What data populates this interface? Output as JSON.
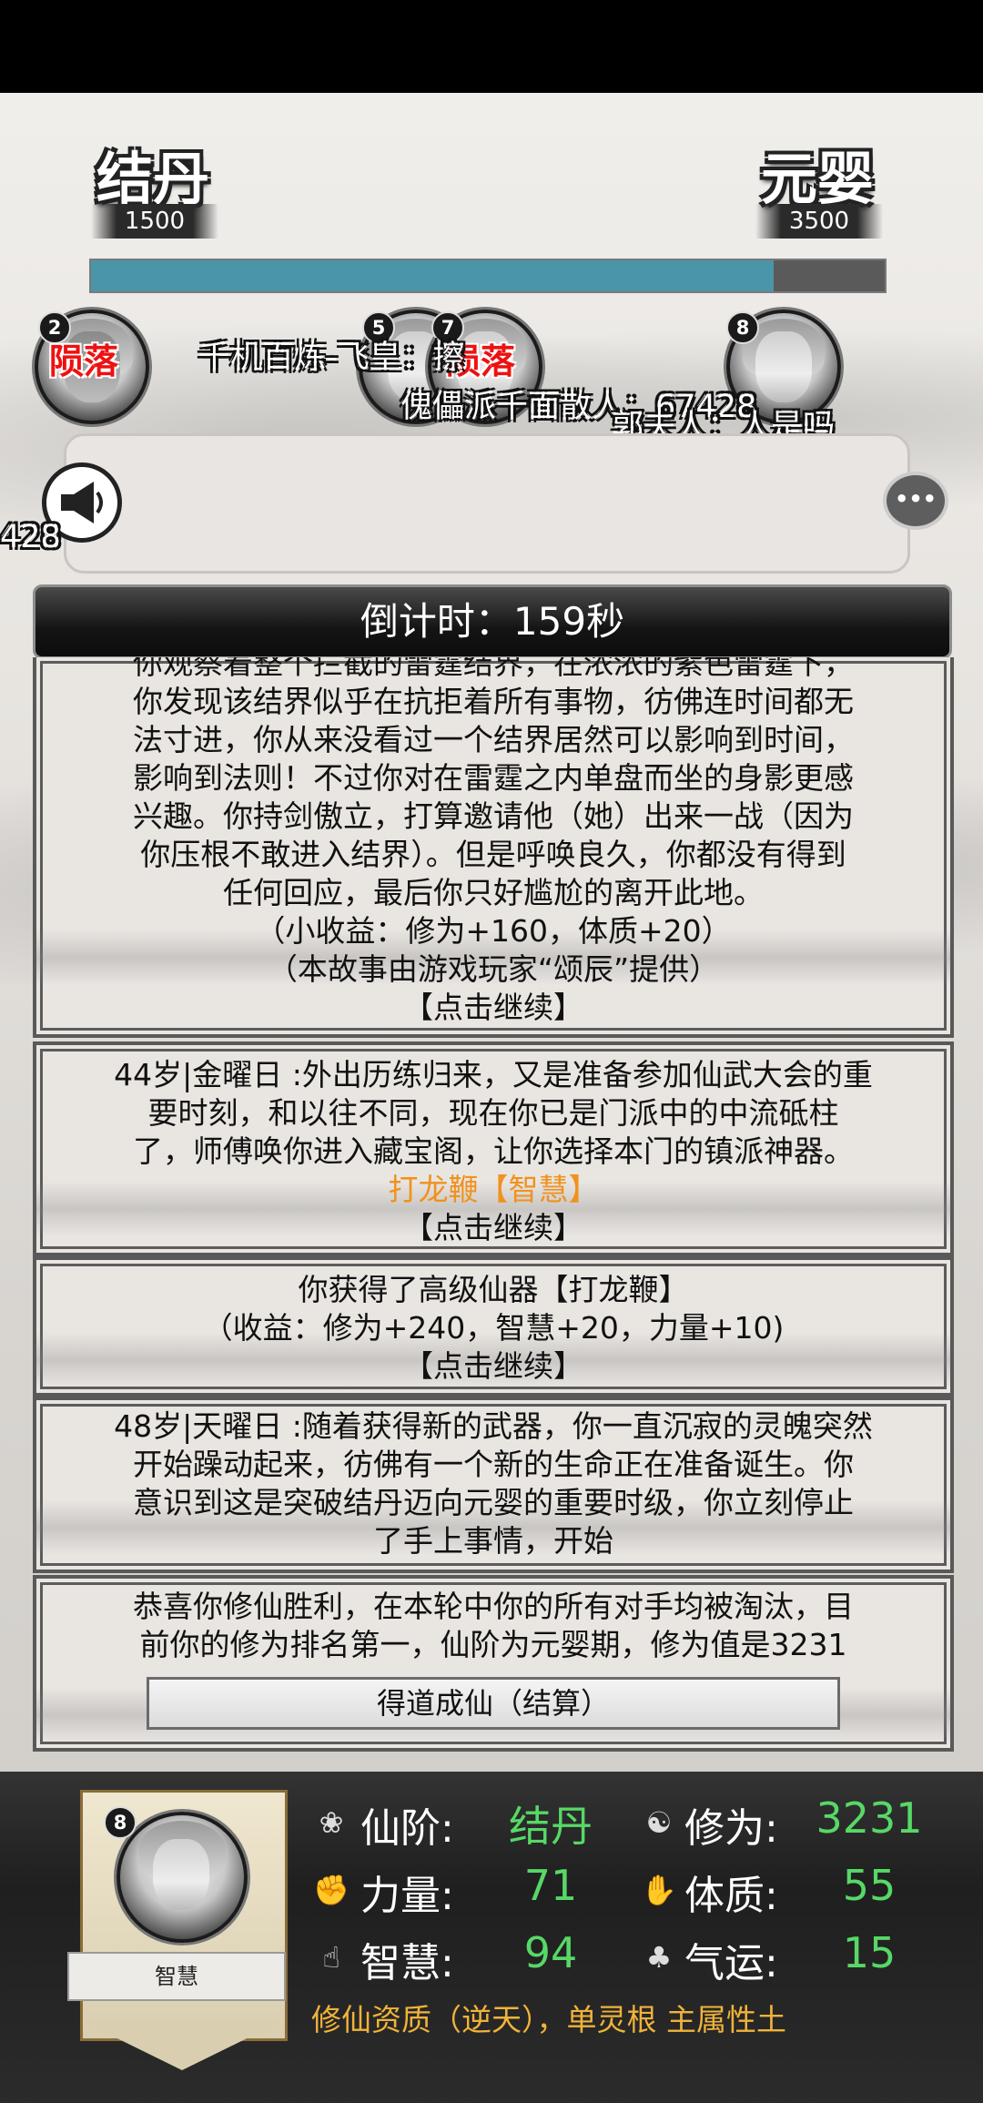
{
  "header": {
    "rank_left": "结丹",
    "rank_left_value": "1500",
    "rank_right": "元婴",
    "rank_right_value": "3500",
    "progress_fraction": 0.86
  },
  "players": [
    {
      "number": "2",
      "status": "陨落"
    },
    {
      "number": "5",
      "status": ""
    },
    {
      "number": "7",
      "status": "陨落"
    },
    {
      "number": "8",
      "status": ""
    }
  ],
  "float_texts": {
    "line1": "千机百炼-飞皇：擦",
    "line2": "傀儡派千面散人：67428",
    "line3": "郭夫人：人是吗",
    "edge": "428"
  },
  "countdown": "倒计时：159秒",
  "story": {
    "card1": {
      "lines": [
        "你观察着整个拦截的雷霆结界，在浓浓的紫色雷霆下，",
        "你发现该结界似乎在抗拒着所有事物，彷佛连时间都无",
        "法寸进，你从来没看过一个结界居然可以影响到时间，",
        "影响到法则！不过你对在雷霆之内单盘而坐的身影更感",
        "兴趣。你持剑傲立，打算邀请他（她）出来一战（因为",
        "你压根不敢进入结界）。但是呼唤良久，你都没有得到",
        "任何回应，最后你只好尴尬的离开此地。"
      ],
      "gain": "（小收益：修为+160，体质+20）",
      "credit": "（本故事由游戏玩家“颂辰”提供）",
      "continue": "【点击继续】"
    },
    "card2": {
      "lines": [
        "44岁|金曜日 :外出历练归来，又是准备参加仙武大会的重",
        "要时刻，和以往不同，现在你已是门派中的中流砥柱",
        "了，师傅唤你进入藏宝阁，让你选择本门的镇派神器。"
      ],
      "item": "打龙鞭【智慧】",
      "continue": "【点击继续】"
    },
    "card3": {
      "line": "你获得了高级仙器【打龙鞭】",
      "gain": "（收益：修为+240，智慧+20，力量+10)",
      "continue": "【点击继续】"
    },
    "card4": {
      "lines": [
        "48岁|天曜日 :随着获得新的武器，你一直沉寂的灵魄突然",
        "开始躁动起来，彷佛有一个新的生命正在准备诞生。你",
        "意识到这是突破结丹迈向元婴的重要时级，你立刻停止",
        "了手上事情，开始"
      ]
    },
    "card5": {
      "lines": [
        "恭喜你修仙胜利，在本轮中你的所有对手均被淘汰，目",
        "前你的修为排名第一，仙阶为元婴期，修为值是3231"
      ],
      "button": "得道成仙（结算）"
    }
  },
  "character": {
    "number": "8",
    "label": "智慧",
    "stats": {
      "realm_label": "仙阶:",
      "realm_value": "结丹",
      "cultivation_label": "修为:",
      "cultivation_value": "3231",
      "strength_label": "力量:",
      "strength_value": "71",
      "constitution_label": "体质:",
      "constitution_value": "55",
      "wisdom_label": "智慧:",
      "wisdom_value": "94",
      "luck_label": "气运:",
      "luck_value": "15"
    },
    "aptitude": "修仙资质（逆天），单灵根 主属性土"
  },
  "colors": {
    "progress": "#4b95a8",
    "stat_value": "#57d867",
    "highlight_orange": "#f0921c",
    "aptitude": "#f0b33a",
    "eliminated_red": "#e11111"
  }
}
